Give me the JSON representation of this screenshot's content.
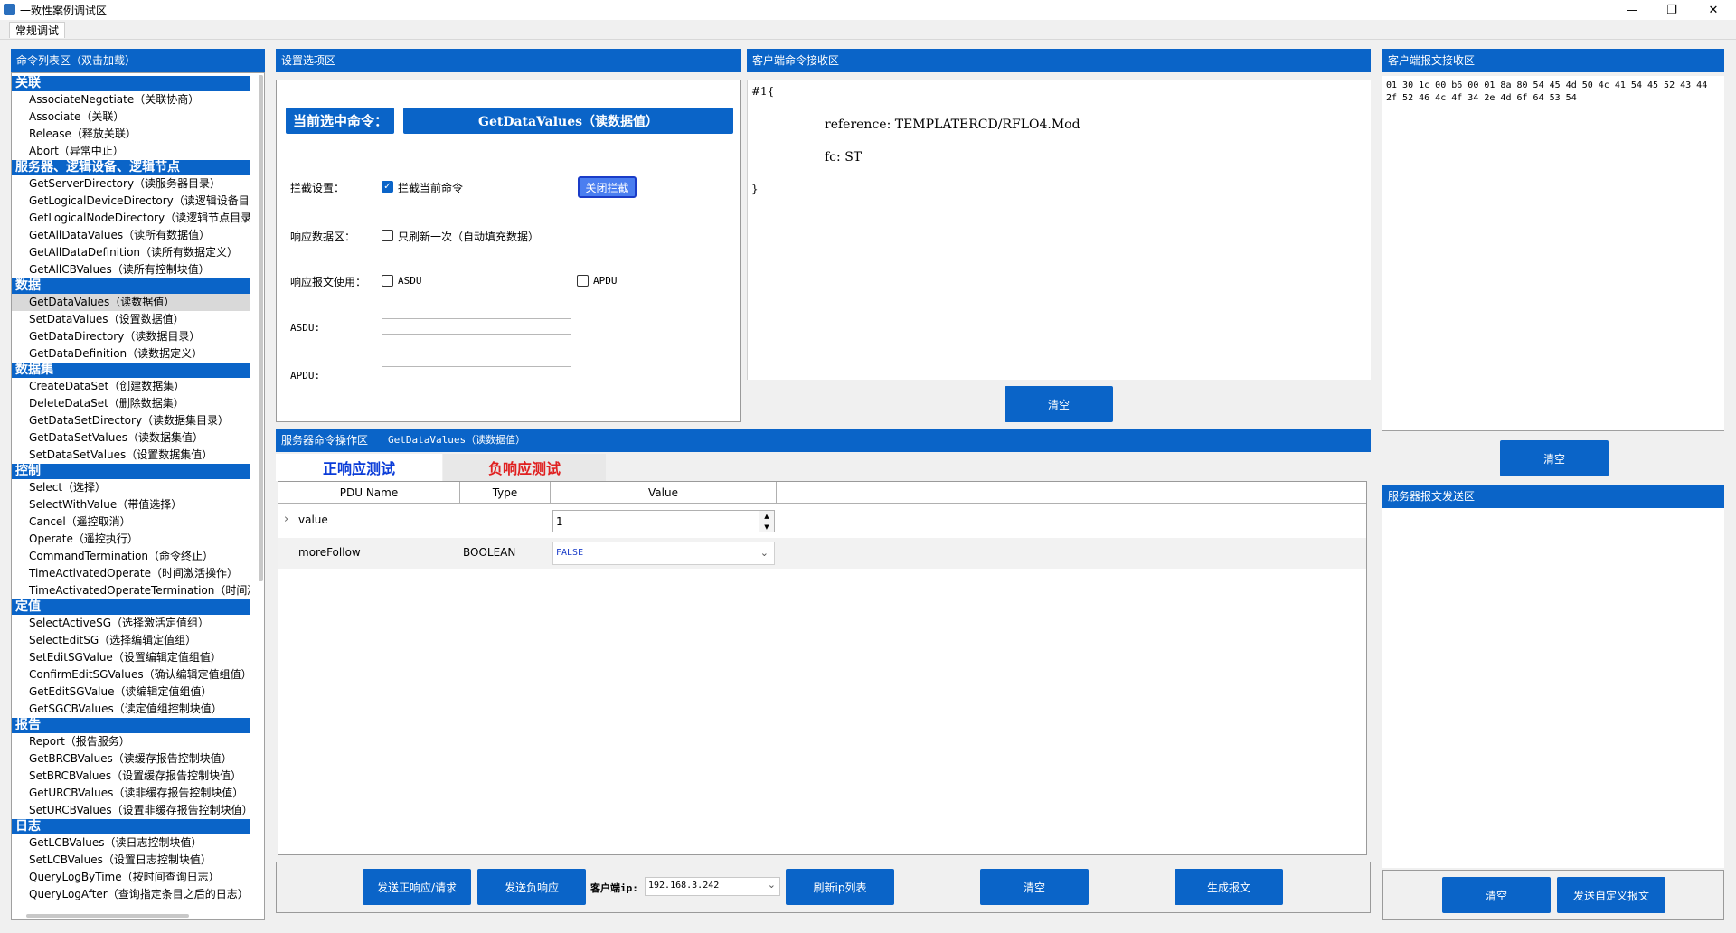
{
  "window": {
    "title": "一致性案例调试区",
    "minimize": "—",
    "maximize": "❐",
    "close": "✕"
  },
  "tabs": {
    "active": "常规调试"
  },
  "command_list": {
    "header": "命令列表区（双击加载）",
    "groups": [
      {
        "title": "关联",
        "items": [
          "AssociateNegotiate（关联协商）",
          "Associate（关联）",
          "Release（释放关联）",
          "Abort（异常中止）"
        ]
      },
      {
        "title": "服务器、逻辑设备、逻辑节点",
        "items": [
          "GetServerDirectory（读服务器目录）",
          "GetLogicalDeviceDirectory（读逻辑设备目录）",
          "GetLogicalNodeDirectory（读逻辑节点目录）",
          "GetAllDataValues（读所有数据值）",
          "GetAllDataDefinition（读所有数据定义）",
          "GetAllCBValues（读所有控制块值）"
        ]
      },
      {
        "title": "数据",
        "items": [
          "GetDataValues（读数据值）",
          "SetDataValues（设置数据值）",
          "GetDataDirectory（读数据目录）",
          "GetDataDefinition（读数据定义）"
        ]
      },
      {
        "title": "数据集",
        "items": [
          "CreateDataSet（创建数据集）",
          "DeleteDataSet（删除数据集）",
          "GetDataSetDirectory（读数据集目录）",
          "GetDataSetValues（读数据集值）",
          "SetDataSetValues（设置数据集值）"
        ]
      },
      {
        "title": "控制",
        "items": [
          "Select（选择）",
          "SelectWithValue（带值选择）",
          "Cancel（遥控取消）",
          "Operate（遥控执行）",
          "CommandTermination（命令终止）",
          "TimeActivatedOperate（时间激活操作）",
          "TimeActivatedOperateTermination（时间激活操作终止）"
        ]
      },
      {
        "title": "定值",
        "items": [
          "SelectActiveSG（选择激活定值组）",
          "SelectEditSG（选择编辑定值组）",
          "SetEditSGValue（设置编辑定值组值）",
          "ConfirmEditSGValues（确认编辑定值组值）",
          "GetEditSGValue（读编辑定值组值）",
          "GetSGCBValues（读定值组控制块值）"
        ]
      },
      {
        "title": "报告",
        "items": [
          "Report（报告服务）",
          "GetBRCBValues（读缓存报告控制块值）",
          "SetBRCBValues（设置缓存报告控制块值）",
          "GetURCBValues（读非缓存报告控制块值）",
          "SetURCBValues（设置非缓存报告控制块值）"
        ]
      },
      {
        "title": "日志",
        "items": [
          "GetLCBValues（读日志控制块值）",
          "SetLCBValues（设置日志控制块值）",
          "QueryLogByTime（按时间查询日志）",
          "QueryLogAfter（查询指定条目之后的日志）"
        ]
      }
    ],
    "selected": "GetDataValues（读数据值）"
  },
  "settings": {
    "header": "设置选项区",
    "current_label": "当前选中命令：",
    "current_value": "GetDataValues（读数据值）",
    "intercept_label": "拦截设置：",
    "intercept_checkbox": "拦截当前命令",
    "intercept_checked": true,
    "close_intercept_button": "关闭拦截",
    "response_area_label": "响应数据区：",
    "refresh_once_checkbox": "只刷新一次（自动填充数据）",
    "refresh_once_checked": false,
    "msg_use_label": "响应报文使用：",
    "asdu_checkbox": "ASDU",
    "apdu_checkbox": "APDU",
    "asdu_checked": false,
    "apdu_checked": false,
    "asdu_field_label": "ASDU:",
    "apdu_field_label": "APDU:",
    "asdu_value": "",
    "apdu_value": ""
  },
  "client_cmd": {
    "header": "客户端命令接收区",
    "lines": [
      "#1{",
      "reference: TEMPLATERCD/RFLO4.Mod",
      "fc: ST",
      "}"
    ],
    "clear_button": "清空"
  },
  "client_msg": {
    "header": "客户端报文接收区",
    "hex_line1": "01 30 1c 00 b6 00 01 8a 80 54 45 4d 50 4c 41 54 45 52 43 44",
    "hex_line2": "2f 52 46 4c 4f 34 2e 4d 6f 64 53 54",
    "clear_button": "清空"
  },
  "server_send": {
    "header": "服务器报文发送区",
    "clear_button": "清空",
    "send_custom_button": "发送自定义报文"
  },
  "server_ops": {
    "header": "服务器命令操作区",
    "header_cmd": "GetDataValues（读数据值）",
    "tab_positive": "正响应测试",
    "tab_negative": "负响应测试",
    "columns": [
      "PDU Name",
      "Type",
      "Value"
    ],
    "rows": [
      {
        "expand": "›",
        "name": "value",
        "type": "",
        "value": "1"
      },
      {
        "expand": "",
        "name": "moreFollow",
        "type": "BOOLEAN",
        "value": "FALSE"
      }
    ],
    "colors": {
      "positive": "#0a3cd8",
      "negative": "#e02020",
      "false_value": "#1a3cc8"
    }
  },
  "bottom_bar": {
    "send_positive": "发送正响应/请求",
    "send_negative": "发送负响应",
    "client_ip_label": "客户端ip:",
    "client_ip_value": "192.168.3.242",
    "refresh_ip": "刷新ip列表",
    "clear": "清空",
    "generate": "生成报文"
  }
}
